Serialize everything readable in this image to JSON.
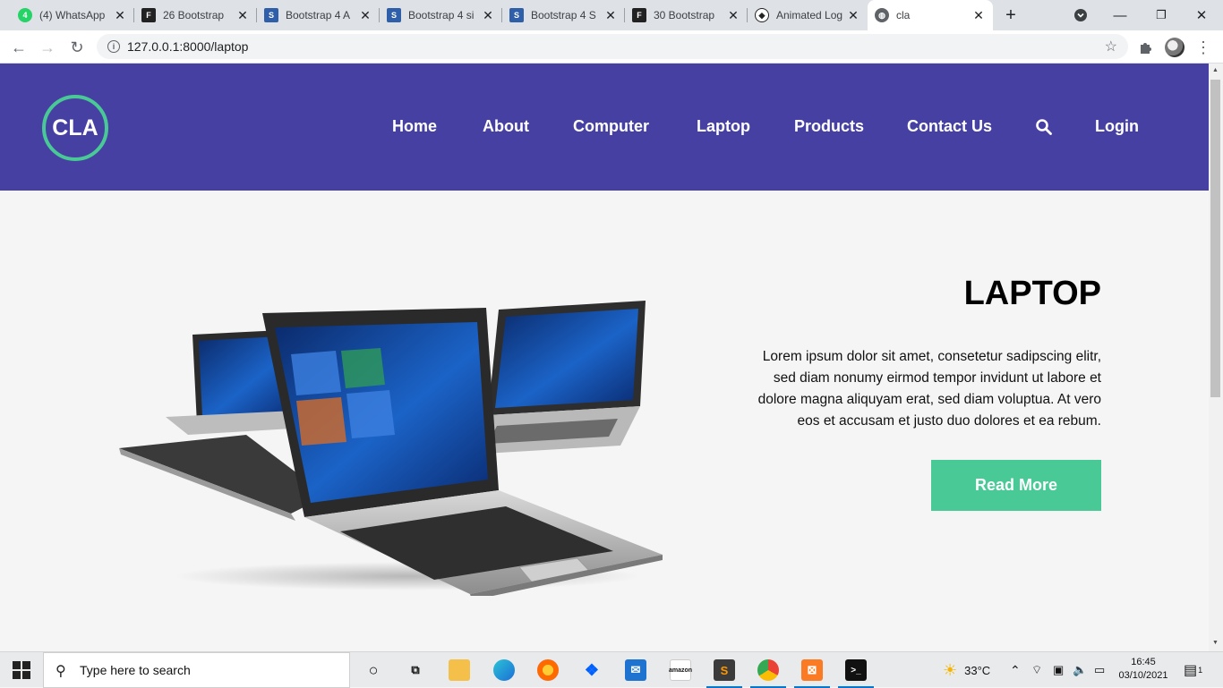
{
  "browser": {
    "tabs": [
      {
        "title": "(4) WhatsApp",
        "icon": "whatsapp-icon",
        "color": "#25d366"
      },
      {
        "title": "26 Bootstrap",
        "icon": "f-letter-icon",
        "color": "#222222"
      },
      {
        "title": "Bootstrap 4 A",
        "icon": "bootstrap-icon",
        "color": "#2f5fa8"
      },
      {
        "title": "Bootstrap 4 si",
        "icon": "bootstrap-icon",
        "color": "#2f5fa8"
      },
      {
        "title": "Bootstrap 4 S",
        "icon": "bootstrap-icon",
        "color": "#2f5fa8"
      },
      {
        "title": "30 Bootstrap",
        "icon": "f-letter-icon",
        "color": "#222222"
      },
      {
        "title": "Animated Log",
        "icon": "codepen-icon",
        "color": "#222222"
      },
      {
        "title": "cla",
        "icon": "globe-icon",
        "color": "#5f6368"
      }
    ],
    "url": "127.0.0.1:8000/laptop"
  },
  "site": {
    "logo": "CLA",
    "nav": [
      "Home",
      "About",
      "Computer",
      "Laptop",
      "Products",
      "Contact Us"
    ],
    "login": "Login",
    "brand_color": "#4740a3",
    "accent_color": "#48c995"
  },
  "hero": {
    "title": "LAPTOP",
    "lines": [
      "Lorem ipsum dolor sit amet, consetetur sadipscing elitr,",
      "sed diam nonumy eirmod tempor invidunt ut labore et",
      "dolore magna aliquyam erat, sed diam voluptua. At vero",
      "eos et accusam et justo duo dolores et ea rebum."
    ],
    "button": "Read More"
  },
  "taskbar": {
    "search_placeholder": "Type here to search",
    "weather": "33°C",
    "time": "16:45",
    "date": "03/10/2021",
    "notification_count": "1"
  }
}
